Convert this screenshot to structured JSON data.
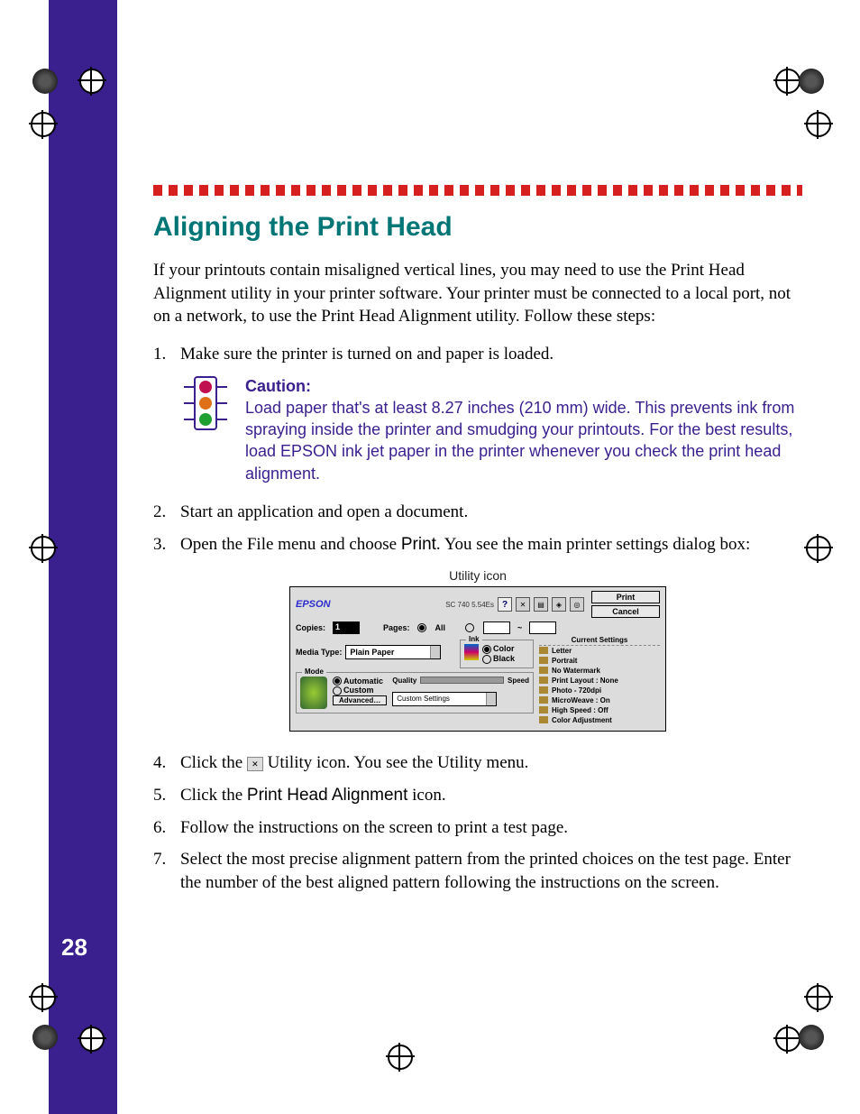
{
  "page_number": "28",
  "heading": "Aligning the Print Head",
  "intro": "If your printouts contain misaligned vertical lines, you may need to use the Print Head Alignment utility in your printer software. Your printer must be connected to a local port, not on a network, to use the Print Head Alignment utility. Follow these steps:",
  "steps": {
    "s1": "Make sure the printer is turned on and paper is loaded.",
    "s2": "Start an application and open a document.",
    "s3a": "Open the File menu and choose ",
    "s3b": "Print",
    "s3c": ". You see the main printer settings dialog box:",
    "s4a": "Click the ",
    "s4b": " Utility icon. You see the Utility menu.",
    "s5a": "Click the ",
    "s5b": "Print Head Alignment",
    "s5c": " icon.",
    "s6": "Follow the instructions on the screen to print a test page.",
    "s7": "Select the most precise alignment pattern from the printed choices on the test page. Enter the number of the best aligned pattern following the instructions on the screen."
  },
  "caution": {
    "title": "Caution:",
    "body": "Load paper that's at least 8.27 inches (210 mm) wide. This prevents ink from spraying inside the printer and smudging your printouts. For the best results, load EPSON ink jet paper in the printer whenever you check the print head alignment."
  },
  "util_caption": "Utility icon",
  "dialog": {
    "logo": "EPSON",
    "version": "SC 740 5.54Es",
    "help": "?",
    "print_btn": "Print",
    "cancel_btn": "Cancel",
    "copies_label": "Copies:",
    "copies_val": "1",
    "pages_label": "Pages:",
    "pages_all": "All",
    "range_sep": "~",
    "media_label": "Media Type:",
    "media_val": "Plain Paper",
    "ink_label": "Ink",
    "ink_color": "Color",
    "ink_black": "Black",
    "mode_label": "Mode",
    "mode_auto": "Automatic",
    "mode_custom": "Custom",
    "advanced_btn": "Advanced…",
    "quality": "Quality",
    "speed": "Speed",
    "custom_settings": "Custom Settings",
    "current_settings": "Current Settings",
    "cs": {
      "letter": "Letter",
      "portrait": "Portrait",
      "nowm": "No Watermark",
      "layout": "Print Layout :    None",
      "photo": "Photo - 720dpi",
      "microweave": "MicroWeave : On",
      "highspeed": "High Speed : Off",
      "coloradj": "Color Adjustment"
    }
  }
}
